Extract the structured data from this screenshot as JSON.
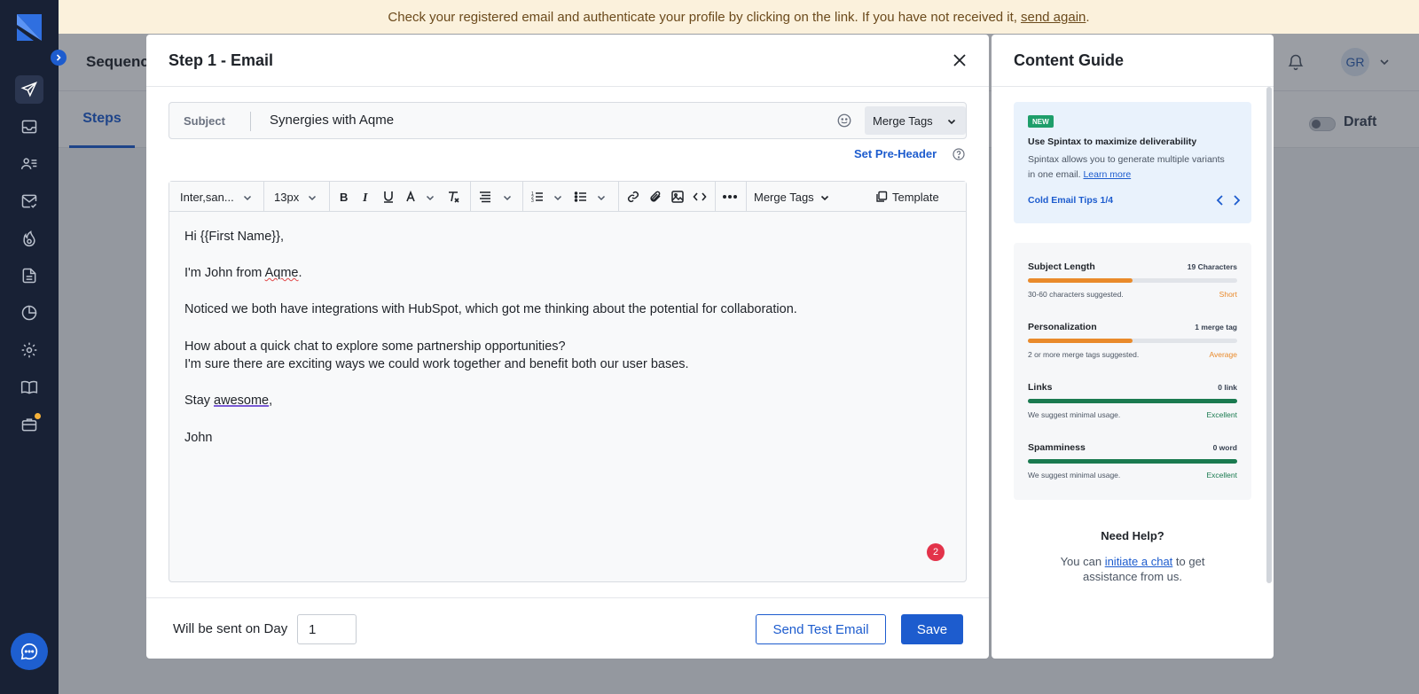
{
  "banner": {
    "text": "Check your registered email and authenticate your profile by clicking on the link. If you have not received it,",
    "link": "send again",
    "suffix": "."
  },
  "header": {
    "page_title": "Sequenc",
    "avatar_initials": "GR"
  },
  "tabs": {
    "steps_label": "Steps",
    "draft_label": "Draft"
  },
  "sidebar": {
    "icons": [
      "paper-plane-icon",
      "inbox-icon",
      "contacts-icon",
      "mail-check-icon",
      "warmup-flame-icon",
      "document-icon",
      "pie-chart-icon",
      "settings-gear-icon",
      "book-icon",
      "briefcase-icon"
    ],
    "chat_icon": "chat-bubble-icon"
  },
  "modal": {
    "title": "Step 1 - Email",
    "subject_label": "Subject",
    "subject_value": "Synergies with Aqme",
    "merge_tags_label": "Merge Tags",
    "set_preheader_label": "Set Pre-Header",
    "toolbar": {
      "font_family": "Inter,san...",
      "font_size": "13px",
      "merge_tags_label": "Merge Tags",
      "template_label": "Template"
    },
    "body": {
      "greeting": "Hi {{First Name}},",
      "intro_prefix": "I'm John from ",
      "intro_company": "Aqme",
      "intro_suffix": ".",
      "line_integrations": "Noticed we both have integrations with HubSpot, which got me thinking about the potential for collaboration.",
      "line_chat": "How about a quick chat to explore some partnership opportunities?",
      "line_benefit": "I'm sure there are exciting ways we could work together and benefit both our user bases.",
      "signoff_prefix": "Stay ",
      "signoff_word": "awesome",
      "signoff_suffix": ",",
      "signature": "John"
    },
    "error_count": "2",
    "footer": {
      "day_label": "Will be sent on Day",
      "day_value": "1",
      "send_test_label": "Send Test Email",
      "save_label": "Save"
    }
  },
  "guide": {
    "title": "Content Guide",
    "tip": {
      "badge": "NEW",
      "heading": "Use Spintax to maximize deliverability",
      "body": "Spintax allows you to generate multiple variants in one email.",
      "link": "Learn more",
      "footer": "Cold Email Tips 1/4"
    },
    "metrics": [
      {
        "name": "Subject Length",
        "value": "19 Characters",
        "hint": "30-60 characters suggested.",
        "rating": "Short",
        "fill": 0.5,
        "color": "#e98a2b"
      },
      {
        "name": "Personalization",
        "value": "1 merge tag",
        "hint": "2 or more merge tags suggested.",
        "rating": "Average",
        "fill": 0.5,
        "color": "#e98a2b"
      },
      {
        "name": "Links",
        "value": "0 link",
        "hint": "We suggest minimal usage.",
        "rating": "Excellent",
        "fill": 1.0,
        "color": "#1a7a50"
      },
      {
        "name": "Spamminess",
        "value": "0 word",
        "hint": "We suggest minimal usage.",
        "rating": "Excellent",
        "fill": 1.0,
        "color": "#1a7a50"
      }
    ],
    "need_help_title": "Need Help?",
    "help_prefix": "You can ",
    "help_link": "initiate a chat",
    "help_suffix": " to get assistance from us."
  },
  "colors": {
    "primary": "#1d5cce",
    "sidebar_bg": "#182135",
    "warning": "#e98a2b",
    "success": "#1a7a50",
    "error_badge": "#e3334a"
  }
}
